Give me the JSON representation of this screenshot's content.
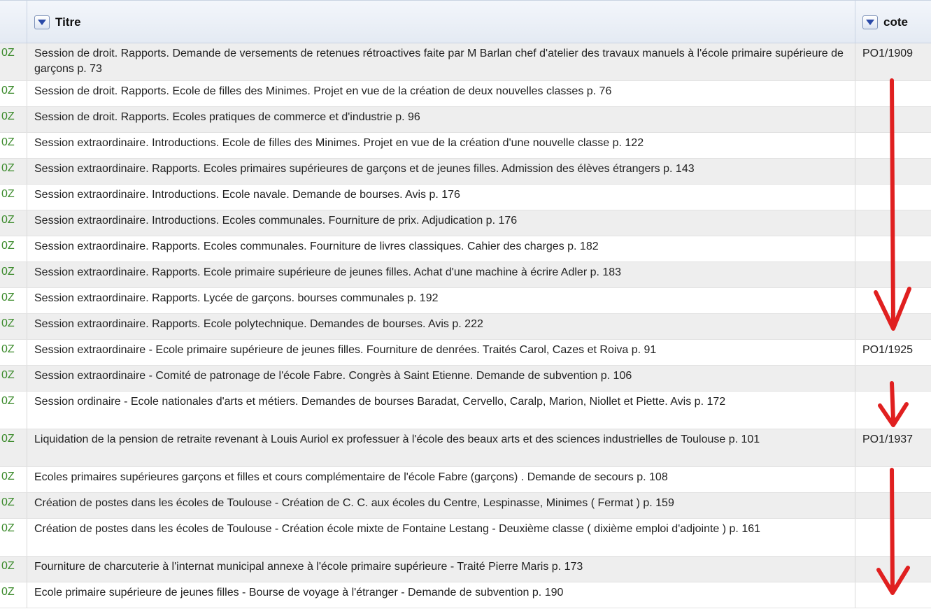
{
  "columns": {
    "titre": "Titre",
    "cote": "cote"
  },
  "rows": [
    {
      "id": "0Z",
      "titre": "Session de droit. Rapports. Demande de versements de retenues rétroactives faite par M Barlan chef d'atelier des travaux manuels à l'école primaire supérieure de garçons p. 73",
      "cote": "PO1/1909"
    },
    {
      "id": "0Z",
      "titre": "Session de droit. Rapports. Ecole de filles des Minimes. Projet en vue de la création de deux nouvelles classes p. 76",
      "cote": ""
    },
    {
      "id": "0Z",
      "titre": "Session de droit. Rapports. Ecoles pratiques de commerce et d'industrie p. 96",
      "cote": ""
    },
    {
      "id": "0Z",
      "titre": "Session extraordinaire. Introductions. Ecole de filles des Minimes. Projet en vue de la création d'une nouvelle classe p. 122",
      "cote": ""
    },
    {
      "id": "0Z",
      "titre": "Session extraordinaire. Rapports. Ecoles primaires supérieures de garçons et de jeunes filles. Admission des élèves étrangers p. 143",
      "cote": ""
    },
    {
      "id": "0Z",
      "titre": "Session extraordinaire. Introductions. Ecole navale. Demande de bourses. Avis p. 176",
      "cote": ""
    },
    {
      "id": "0Z",
      "titre": "Session extraordinaire. Introductions. Ecoles communales. Fourniture de prix. Adjudication p. 176",
      "cote": ""
    },
    {
      "id": "0Z",
      "titre": "Session extraordinaire. Rapports. Ecoles communales. Fourniture de livres classiques. Cahier des charges p. 182",
      "cote": ""
    },
    {
      "id": "0Z",
      "titre": "Session extraordinaire. Rapports. Ecole primaire supérieure de jeunes filles. Achat d'une machine à écrire Adler p. 183",
      "cote": ""
    },
    {
      "id": "0Z",
      "titre": "Session extraordinaire. Rapports. Lycée de garçons. bourses communales p. 192",
      "cote": ""
    },
    {
      "id": "0Z",
      "titre": "Session extraordinaire. Rapports. Ecole polytechnique. Demandes de bourses. Avis p. 222",
      "cote": ""
    },
    {
      "id": "0Z",
      "titre": "Session extraordinaire - Ecole primaire supérieure de jeunes filles. Fourniture de denrées. Traités Carol, Cazes et Roiva p. 91",
      "cote": "PO1/1925"
    },
    {
      "id": "0Z",
      "titre": "Session extraordinaire - Comité de patronage de l'école Fabre. Congrès à Saint Etienne. Demande de subvention p. 106",
      "cote": ""
    },
    {
      "id": "0Z",
      "titre": "Session ordinaire - Ecole nationales d'arts et métiers. Demandes de bourses Baradat, Cervello, Caralp, Marion, Niollet et Piette. Avis p. 172",
      "cote": ""
    },
    {
      "id": "0Z",
      "titre": "Liquidation de la pension de retraite revenant à Louis Auriol ex professuer à l'école des beaux arts et des sciences industrielles de Toulouse p. 101",
      "cote": "PO1/1937"
    },
    {
      "id": "0Z",
      "titre": "Ecoles primaires supérieures garçons et filles et cours complémentaire de l'école Fabre (garçons) . Demande de secours p. 108",
      "cote": ""
    },
    {
      "id": "0Z",
      "titre": "Création de postes dans les écoles de Toulouse - Création de C. C. aux écoles du Centre, Lespinasse, Minimes ( Fermat ) p. 159",
      "cote": ""
    },
    {
      "id": "0Z",
      "titre": "Création de postes dans les écoles de Toulouse - Création école mixte de Fontaine Lestang - Deuxième classe ( dixième emploi d'adjointe ) p. 161",
      "cote": ""
    },
    {
      "id": "0Z",
      "titre": "Fourniture de charcuterie à l'internat municipal annexe à l'école primaire supérieure - Traité Pierre Maris p. 173",
      "cote": ""
    },
    {
      "id": "0Z",
      "titre": "Ecole primaire supérieure de jeunes filles - Bourse de voyage à l'étranger - Demande de subvention p. 190",
      "cote": ""
    }
  ],
  "annotation_color": "#e02020"
}
